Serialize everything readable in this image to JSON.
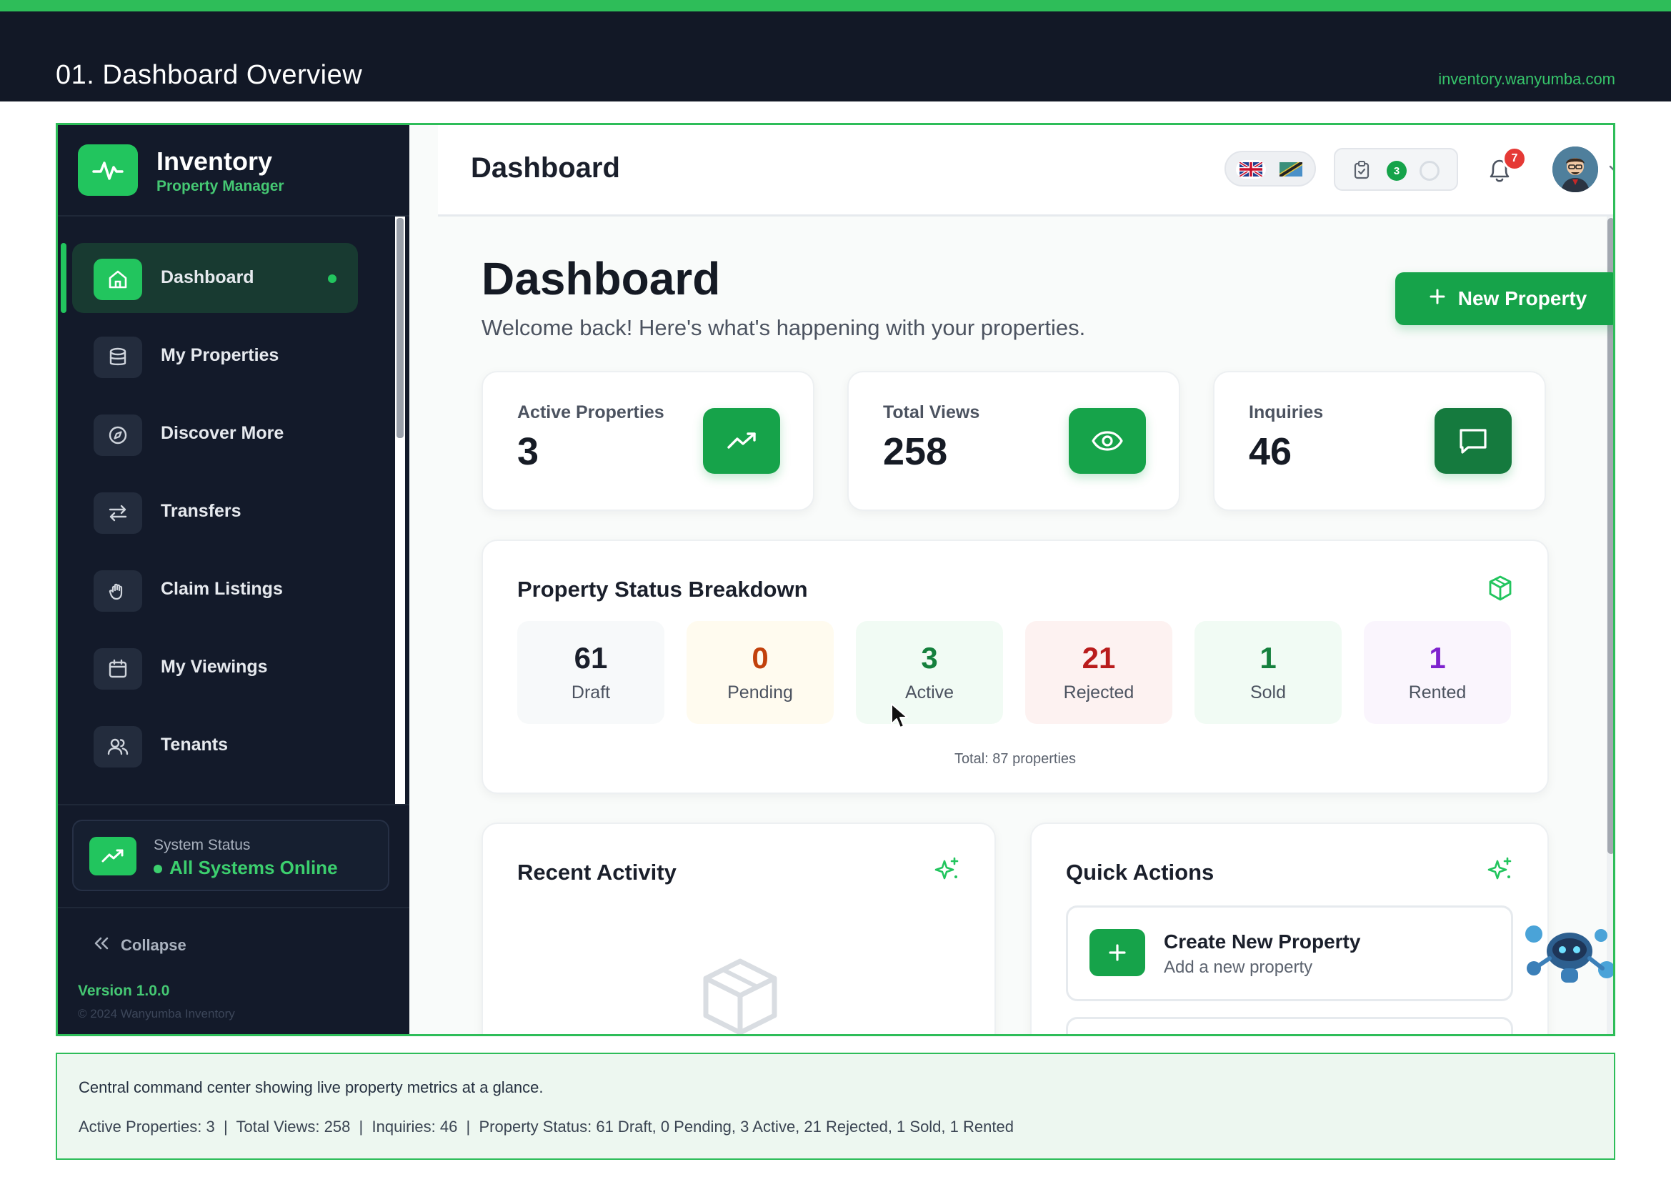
{
  "page": {
    "title": "01. Dashboard Overview",
    "url": "inventory.wanyumba.com"
  },
  "sidebar": {
    "brand": {
      "name": "Inventory",
      "subtitle": "Property Manager"
    },
    "items": [
      {
        "label": "Dashboard",
        "icon": "home-icon",
        "active": true
      },
      {
        "label": "My Properties",
        "icon": "database-icon",
        "active": false
      },
      {
        "label": "Discover More",
        "icon": "compass-icon",
        "active": false
      },
      {
        "label": "Transfers",
        "icon": "transfer-arrows-icon",
        "active": false
      },
      {
        "label": "Claim Listings",
        "icon": "hand-icon",
        "active": false
      },
      {
        "label": "My Viewings",
        "icon": "calendar-icon",
        "active": false
      },
      {
        "label": "Tenants",
        "icon": "users-icon",
        "active": false
      }
    ],
    "system": {
      "title": "System Status",
      "status": "All Systems Online"
    },
    "collapse_label": "Collapse",
    "version": "Version 1.0.0",
    "copyright": "© 2024 Wanyumba Inventory"
  },
  "topbar": {
    "title": "Dashboard",
    "task_count": "3",
    "notification_count": "7"
  },
  "main": {
    "title": "Dashboard",
    "subtitle": "Welcome back! Here's what's happening with your properties.",
    "new_property_label": "New Property",
    "stats": [
      {
        "label": "Active Properties",
        "value": "3",
        "icon": "trending-up-icon"
      },
      {
        "label": "Total Views",
        "value": "258",
        "icon": "eye-icon"
      },
      {
        "label": "Inquiries",
        "value": "46",
        "icon": "message-icon"
      }
    ],
    "status_breakdown": {
      "title": "Property Status Breakdown",
      "tiles": [
        {
          "value": "61",
          "label": "Draft",
          "color": "#1a1f2b",
          "bg": "#f7f9fa"
        },
        {
          "value": "0",
          "label": "Pending",
          "color": "#c2410c",
          "bg": "#fffbef"
        },
        {
          "value": "3",
          "label": "Active",
          "color": "#15803d",
          "bg": "#f1fbf4"
        },
        {
          "value": "21",
          "label": "Rejected",
          "color": "#b91c1c",
          "bg": "#fdf2f1"
        },
        {
          "value": "1",
          "label": "Sold",
          "color": "#15803d",
          "bg": "#f1fbf4"
        },
        {
          "value": "1",
          "label": "Rented",
          "color": "#7e22ce",
          "bg": "#faf5fd"
        }
      ],
      "total": "Total: 87 properties"
    },
    "recent_activity": {
      "title": "Recent Activity"
    },
    "quick_actions": {
      "title": "Quick Actions",
      "items": [
        {
          "title": "Create New Property",
          "subtitle": "Add a new property"
        }
      ]
    }
  },
  "caption": {
    "line1": "Central command center showing live property metrics at a glance.",
    "line2": "Active Properties: 3  |  Total Views: 258  |  Inquiries: 46  |  Property Status: 61 Draft, 0 Pending, 3 Active, 21 Rejected, 1 Sold, 1 Rented"
  },
  "colors": {
    "accent": "#22c55e",
    "sidebar_bg": "#131a2a",
    "header_bg": "#121826"
  }
}
